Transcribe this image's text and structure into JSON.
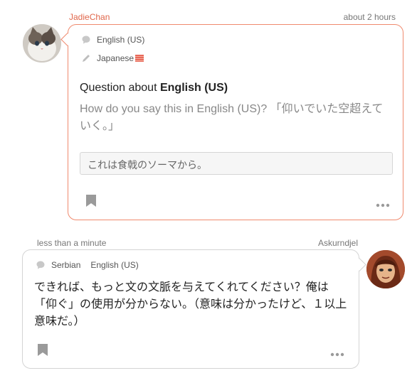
{
  "question": {
    "author": "JadieChan",
    "time": "about 2 hours",
    "language_primary": "English (US)",
    "language_secondary": "Japanese",
    "title_prefix": "Question about",
    "title_lang": "English (US)",
    "body": "How do you say this in English (US)? 「仰いでいた空超えていく。」",
    "input_text": "これは食戟のソーマから。",
    "icons": {
      "lang_primary": "speech-bubble-icon",
      "lang_secondary": "pencil-icon",
      "flag": "flag-icon",
      "bookmark": "bookmark-icon",
      "more": "more-dots-icon"
    }
  },
  "answer": {
    "time": "less than a minute",
    "author": "Askurndjel",
    "language_1": "Serbian",
    "language_2": "English (US)",
    "body": "できれば、もっと文の文脈を与えてくれてください？俺は「仰ぐ」の使用が分からない。（意味は分かったけど、１以上意味だ。）",
    "icons": {
      "lang": "speech-bubble-icon",
      "bookmark": "bookmark-icon",
      "more": "more-dots-icon"
    }
  },
  "colors": {
    "accent": "#f08a6e",
    "author_link": "#e0664a",
    "muted_text": "#888888",
    "border": "#d4d4d4"
  }
}
